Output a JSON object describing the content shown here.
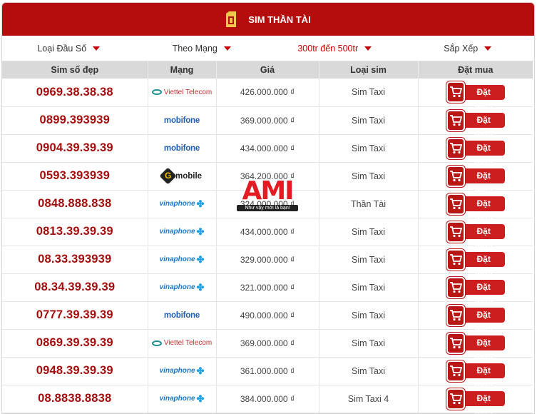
{
  "header": {
    "title": "SIM THẦN TÀI",
    "icon": "sim-card-icon"
  },
  "filters": [
    {
      "label": "Loại Đầu Số",
      "active": false
    },
    {
      "label": "Theo Mạng",
      "active": false
    },
    {
      "label": "300tr đến 500tr",
      "active": true
    },
    {
      "label": "Sắp Xếp",
      "active": false
    }
  ],
  "columns": [
    "Sim số đẹp",
    "Mạng",
    "Giá",
    "Loại sim",
    "Đặt mua"
  ],
  "buy_label": "Đặt mua",
  "networks": {
    "viettel": "Viettel Telecom",
    "mobifone": "mobifone",
    "vinaphone": "vinaphone",
    "gmobile": "mobile"
  },
  "rows": [
    {
      "number": "0969.38.38.38",
      "network": "viettel",
      "price": "426.000.000 ₫",
      "type": "Sim Taxi"
    },
    {
      "number": "0899.393939",
      "network": "mobifone",
      "price": "369.000.000 ₫",
      "type": "Sim Taxi"
    },
    {
      "number": "0904.39.39.39",
      "network": "mobifone",
      "price": "434.000.000 ₫",
      "type": "Sim Taxi"
    },
    {
      "number": "0593.393939",
      "network": "gmobile",
      "price": "364.200.000 ₫",
      "type": "Sim Taxi"
    },
    {
      "number": "0848.888.838",
      "network": "vinaphone",
      "price": "324.000.000 ₫",
      "type": "Thần Tài"
    },
    {
      "number": "0813.39.39.39",
      "network": "vinaphone",
      "price": "434.000.000 ₫",
      "type": "Sim Taxi"
    },
    {
      "number": "08.33.393939",
      "network": "vinaphone",
      "price": "329.000.000 ₫",
      "type": "Sim Taxi"
    },
    {
      "number": "08.34.39.39.39",
      "network": "vinaphone",
      "price": "321.000.000 ₫",
      "type": "Sim Taxi"
    },
    {
      "number": "0777.39.39.39",
      "network": "mobifone",
      "price": "490.000.000 ₫",
      "type": "Sim Taxi"
    },
    {
      "number": "0869.39.39.39",
      "network": "viettel",
      "price": "369.000.000 ₫",
      "type": "Sim Taxi"
    },
    {
      "number": "0948.39.39.39",
      "network": "vinaphone",
      "price": "361.000.000 ₫",
      "type": "Sim Taxi"
    },
    {
      "number": "08.8838.8838",
      "network": "vinaphone",
      "price": "384.000.000 ₫",
      "type": "Sim Taxi 4"
    }
  ],
  "watermark": {
    "logo": "AMI",
    "slogan": "Như vậy mới là bạn!"
  },
  "colors": {
    "brand_red": "#b50d0d",
    "number_red": "#a50d0d",
    "header_gray": "#d9d9d9"
  }
}
